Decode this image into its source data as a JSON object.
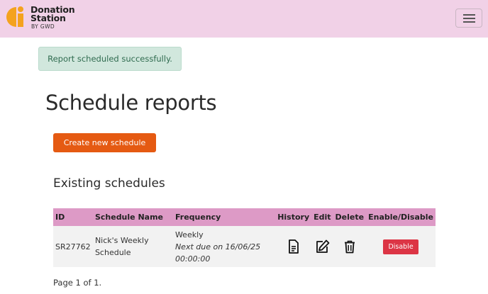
{
  "brand": {
    "line1": "Donation",
    "line2": "Station",
    "sub": "BY GWD"
  },
  "colors": {
    "navbar": "#f1d1e7",
    "accent": "#e55a12",
    "table_header": "#dd9ac6",
    "danger": "#dc3545",
    "success_bg": "#d1e7dd"
  },
  "alert": {
    "message": "Report scheduled successfully."
  },
  "page": {
    "title": "Schedule reports",
    "create_button": "Create new schedule",
    "section_title": "Existing schedules"
  },
  "table": {
    "headers": {
      "id": "ID",
      "name": "Schedule Name",
      "frequency": "Frequency",
      "history": "History",
      "edit": "Edit",
      "delete": "Delete",
      "toggle": "Enable/Disable"
    },
    "rows": [
      {
        "id": "SR27762",
        "name_line1": "Nick's Weekly",
        "name_line2": "Schedule",
        "frequency": "Weekly",
        "next_due_line1": "Next due on 16/06/25",
        "next_due_line2": "00:00:00",
        "history_icon": "document-icon",
        "edit_icon": "edit-icon",
        "delete_icon": "trash-icon",
        "toggle_label": "Disable"
      }
    ]
  },
  "pagination": {
    "text": "Page 1 of 1."
  }
}
